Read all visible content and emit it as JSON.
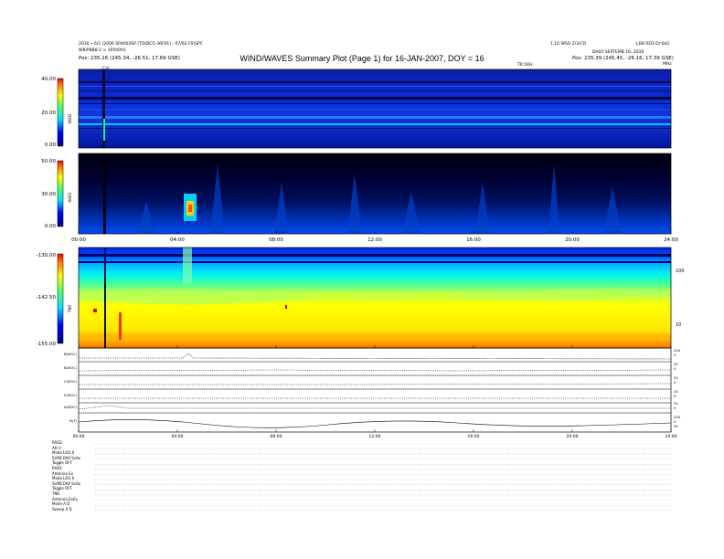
{
  "header": {
    "title": "WIND/WAVES Summary Plot (Page 1) for 16-JAN-2007, DOY = 16",
    "left_line1": "2030 • 6/1 (2006 SP4003SP (TOIDCO 36F91) - 07/02 F0)SPC",
    "left_line2": "WB/P8B8-2 × 1050001",
    "left_pos": "Pos: 235.16 (245.34, -26.51, 17.69 GSE)",
    "right_line1": "1.10 WSO 2/3/CD",
    "right_line1b": "LD8 RD3 Dr:6d1",
    "right_line2": "DAILY SEPTEMB 16, 2010",
    "right_pos": "Pos: 235.39 (245.45, -26.16, 17.39 GSE)",
    "cal_label": "Cal",
    "tnr_right_label": "TR:MR",
    "tnr_mid_label": "TR:1KH"
  },
  "panels": {
    "rad2": {
      "label": "RAD2",
      "ticks": [
        "40.00",
        "20.00",
        "0.00"
      ],
      "unit": "MHz"
    },
    "rad1": {
      "label": "RAD1",
      "ticks": [
        "50.00",
        "30.00",
        "0.00"
      ]
    },
    "tnr": {
      "label": "TNR",
      "ticks": [
        "-130.00",
        "-142.50",
        "-155.00"
      ],
      "right_ticks": [
        "100",
        "10"
      ]
    },
    "time_ticks": [
      "00:00",
      "04:00",
      "08:00",
      "12:00",
      "16:00",
      "20:00",
      "24:00"
    ]
  },
  "line_panels": [
    {
      "label": "B(NOC)",
      "right": [
        "250",
        "0"
      ]
    },
    {
      "label": "B(NOC)",
      "right": [
        "20",
        "0"
      ]
    },
    {
      "label": "C(NOC)",
      "right": [
        "20",
        "0"
      ]
    },
    {
      "label": "E(NOC)",
      "right": [
        "20",
        "0"
      ]
    },
    {
      "label": "A(NOC)",
      "right": [
        "20",
        "0"
      ]
    },
    {
      "label": "B(T)",
      "right": [
        "250",
        "0",
        "50"
      ]
    }
  ],
  "footer": {
    "lines": [
      "RAD2",
      "Att      0",
      "Mode   LOG 0",
      "SUMCOAP  ScAo",
      "Toggle   OFF",
      "RAD1",
      "Antenna    Ex",
      "Mode   LOG 0",
      "SUMCOAP  ScAo",
      "Toggle   OFF",
      "TNR",
      "Antenna   ExEy",
      "Mode   A D",
      "Sweep   A D"
    ]
  },
  "chart_data": [
    {
      "type": "heatmap",
      "title": "RAD2",
      "xlabel": "",
      "ylabel": "RAD2",
      "x_range": [
        "00:00",
        "24:00"
      ],
      "ylim": [
        0,
        40
      ],
      "colormap": "rainbow",
      "features": [
        "vertical calibration stripe near 01:10",
        "horizontal bands of interference"
      ]
    },
    {
      "type": "heatmap",
      "title": "RAD1",
      "ylabel": "RAD1",
      "x_range": [
        "00:00",
        "24:00"
      ],
      "ylim": [
        0,
        50
      ],
      "colormap": "rainbow",
      "features": [
        "type III burst near 04:00"
      ]
    },
    {
      "type": "heatmap",
      "title": "TNR",
      "ylabel": "TNR",
      "x_range": [
        "00:00",
        "24:00"
      ],
      "ylim": [
        -155,
        -130
      ],
      "colormap": "rainbow"
    }
  ]
}
